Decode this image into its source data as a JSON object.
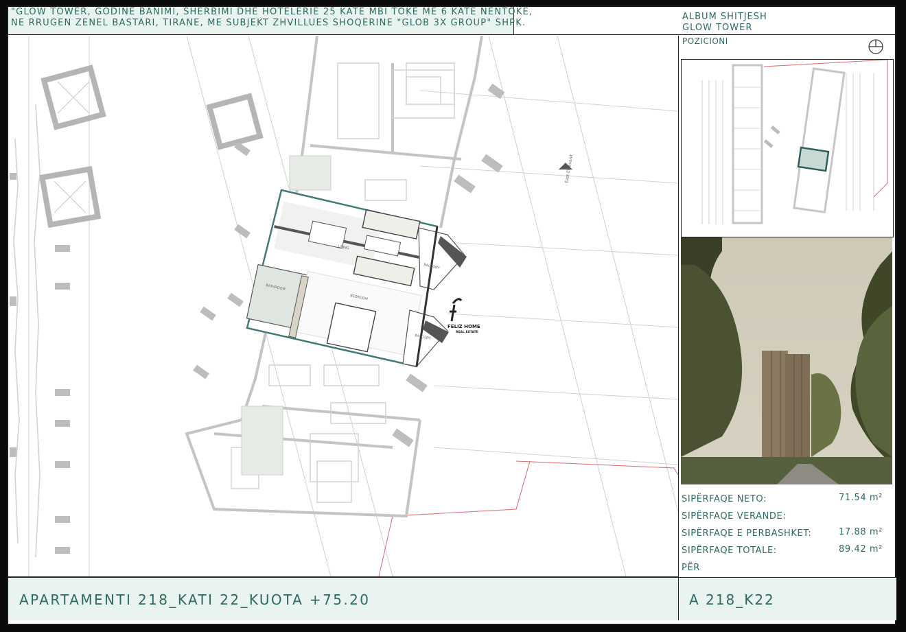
{
  "header": {
    "title_line1": "\"GLOW TOWER, GODINE BANIMI, SHERBIMI DHE HOTELERIE 25 KATE MBI TOKE ME 6 KATE NENTOKE,",
    "title_line2": "NE RRUGEN ZENEL BASTARI, TIRANE, ME SUBJEKT ZHVILLUES SHOQERINE \"GLOB 3X GROUP\" SHPK.",
    "album_line1": "ALBUM SHITJESH",
    "album_line2": "GLOW TOWER"
  },
  "side": {
    "position_label": "POZICIONI",
    "areas": [
      {
        "label": "SIPËRFAQE NETO:",
        "value": "71.54 m²"
      },
      {
        "label": "SIPËRFAQE VERANDE:",
        "value": ""
      },
      {
        "label": "SIPËRFAQE E PERBASHKET:",
        "value": "17.88 m²"
      },
      {
        "label": "SIPËRFAQE TOTALE:",
        "value": "89.42 m²"
      },
      {
        "label": "PËR",
        "value": ""
      }
    ]
  },
  "plan": {
    "room_labels": {
      "living": "LIVING",
      "bedroom": "BEDROOM",
      "bathroom": "BATHROOM",
      "balcony1": "BALCONY",
      "balcony2": "BALCONY"
    },
    "street_label": "East Elbasanit",
    "watermark_name": "FELIZ HOME",
    "watermark_sub": "REAL ESTATE"
  },
  "footer": {
    "apartment_label": "APARTAMENTI 218_KATI 22_KUOTA +75.20",
    "code": "A 218_K22"
  },
  "colors": {
    "accent": "#2d6a63",
    "highlight": "#3f7a74",
    "panel_bg": "#e9f3ef"
  }
}
